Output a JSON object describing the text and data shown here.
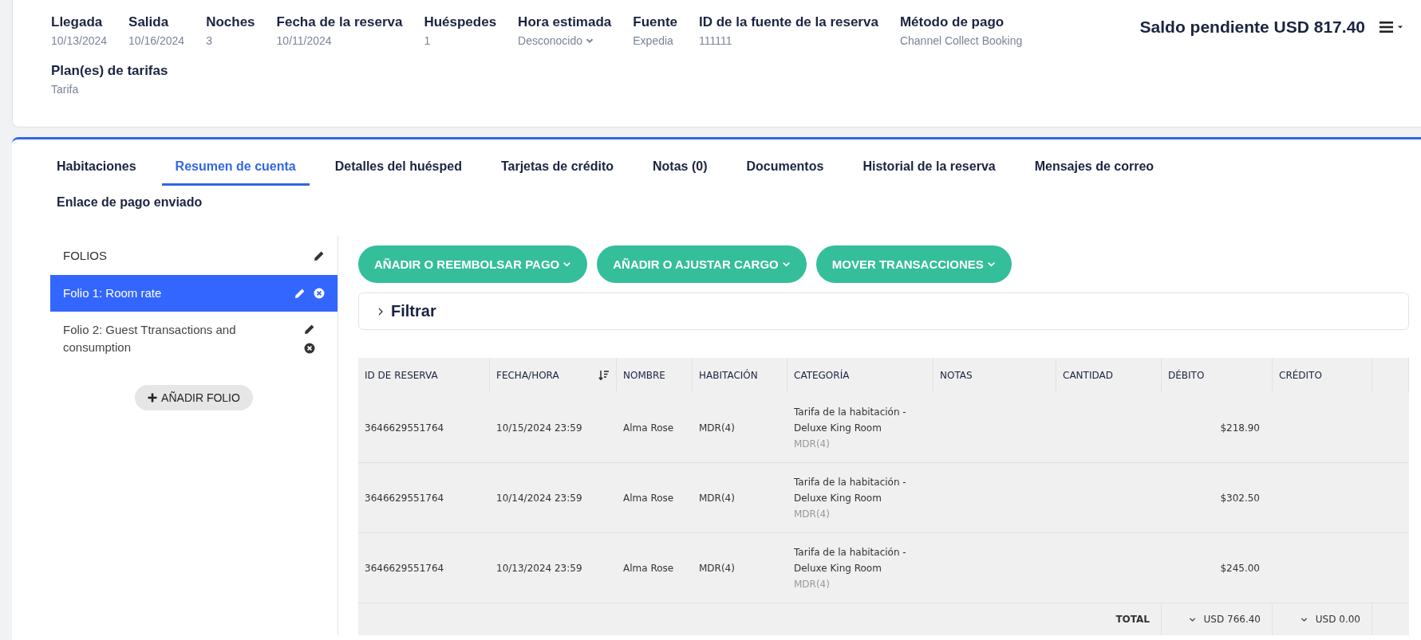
{
  "header": {
    "fields": [
      {
        "label": "Llegada",
        "value": "10/13/2024",
        "kind": "text"
      },
      {
        "label": "Salida",
        "value": "10/16/2024",
        "kind": "text"
      },
      {
        "label": "Noches",
        "value": "3",
        "kind": "text"
      },
      {
        "label": "Fecha de la reserva",
        "value": "10/11/2024",
        "kind": "text"
      },
      {
        "label": "Huéspedes",
        "value": "1",
        "kind": "text"
      },
      {
        "label": "Hora estimada",
        "value": "Desconocido",
        "kind": "dropdown"
      },
      {
        "label": "Fuente",
        "value": "Expedia",
        "kind": "text"
      },
      {
        "label": "ID de la fuente de la reserva",
        "value": "111111",
        "kind": "text"
      },
      {
        "label": "Método de pago",
        "value": "Channel Collect Booking",
        "kind": "text"
      }
    ],
    "rate_plan": {
      "label": "Plan(es) de tarifas",
      "value": "Tarifa"
    },
    "balance": "Saldo pendiente USD 817.40"
  },
  "tabs": [
    {
      "label": "Habitaciones",
      "selected": false
    },
    {
      "label": "Resumen de cuenta",
      "selected": true
    },
    {
      "label": "Detalles del huésped",
      "selected": false
    },
    {
      "label": "Tarjetas de crédito",
      "selected": false
    },
    {
      "label": "Notas (0)",
      "selected": false
    },
    {
      "label": "Documentos",
      "selected": false
    },
    {
      "label": "Historial de la reserva",
      "selected": false
    },
    {
      "label": "Mensajes de correo",
      "selected": false
    },
    {
      "label": "Enlace de pago enviado",
      "selected": false
    }
  ],
  "folios": {
    "title": "FOLIOS",
    "items": [
      {
        "label": "Folio 1: Room rate",
        "selected": true
      },
      {
        "label": "Folio 2: Guest Ttransactions and consumption",
        "selected": false
      }
    ],
    "add_button": "AÑADIR FOLIO"
  },
  "actions": [
    "AÑADIR O REEMBOLSAR PAGO",
    "AÑADIR O AJUSTAR CARGO",
    "MOVER TRANSACCIONES"
  ],
  "filter": {
    "label": "Filtrar",
    "expanded": false
  },
  "table": {
    "columns": [
      {
        "label": "ID DE RESERVA",
        "sortable": false
      },
      {
        "label": "FECHA/HORA",
        "sortable": true
      },
      {
        "label": "NOMBRE",
        "sortable": false
      },
      {
        "label": "HABITACIÓN",
        "sortable": false
      },
      {
        "label": "CATEGORÍA",
        "sortable": false
      },
      {
        "label": "NOTAS",
        "sortable": false
      },
      {
        "label": "CANTIDAD",
        "sortable": false
      },
      {
        "label": "DÉBITO",
        "sortable": false
      },
      {
        "label": "CRÉDITO",
        "sortable": false
      }
    ],
    "rows": [
      {
        "id": "3646629551764",
        "datetime": "10/15/2024 23:59",
        "name": "Alma Rose",
        "room": "MDR(4)",
        "category": "Tarifa de la habitación - Deluxe King Room",
        "category_sub": "MDR(4)",
        "debit": "$218.90"
      },
      {
        "id": "3646629551764",
        "datetime": "10/14/2024 23:59",
        "name": "Alma Rose",
        "room": "MDR(4)",
        "category": "Tarifa de la habitación - Deluxe King Room",
        "category_sub": "MDR(4)",
        "debit": "$302.50"
      },
      {
        "id": "3646629551764",
        "datetime": "10/13/2024 23:59",
        "name": "Alma Rose",
        "room": "MDR(4)",
        "category": "Tarifa de la habitación - Deluxe King Room",
        "category_sub": "MDR(4)",
        "debit": "$245.00"
      }
    ],
    "total": {
      "label": "TOTAL",
      "debit": "USD 766.40",
      "credit": "USD 0.00"
    }
  }
}
